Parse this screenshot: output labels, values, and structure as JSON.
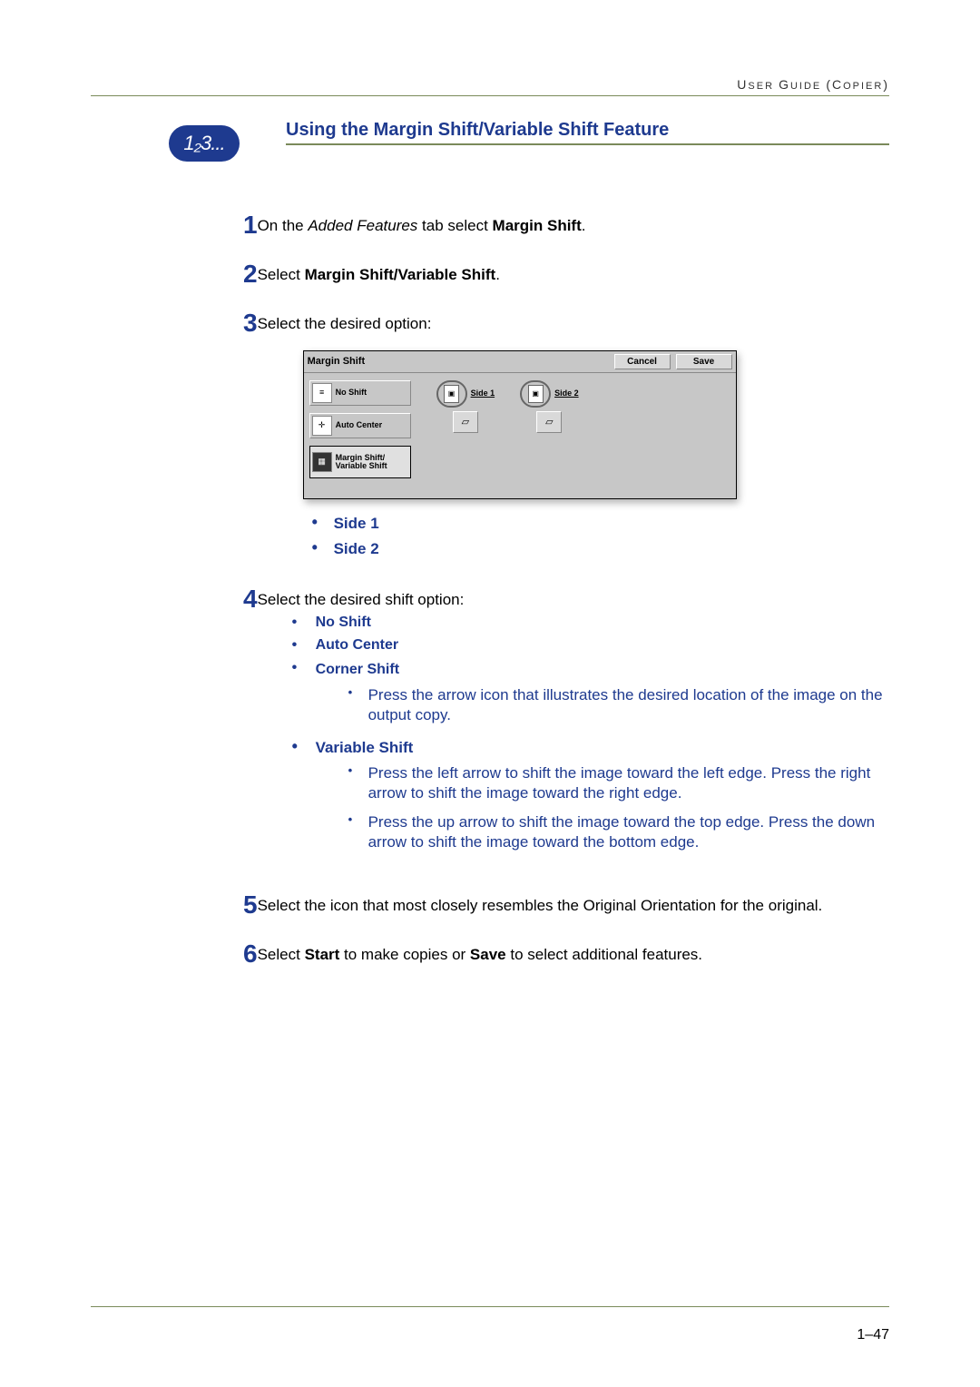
{
  "header": {
    "right_1": "U",
    "right_2": "SER ",
    "right_3": "G",
    "right_4": "UIDE ",
    "right_5": "(C",
    "right_6": "OPIER",
    "right_7": ")"
  },
  "title": "Using the Margin Shift/Variable Shift Feature",
  "step_icon": "1₂3...",
  "steps": {
    "s1": {
      "num": "1",
      "txt1": "On the ",
      "txt2": "Added Features",
      "txt3": " tab select ",
      "txt4": "Margin Shift",
      "txt5": "."
    },
    "s2": {
      "num": "2",
      "txt1": "Select ",
      "txt2": "Margin Shift/Variable Shift",
      "txt3": "."
    },
    "s3": {
      "num": "3",
      "txt": "Select the desired option:"
    },
    "s4": {
      "num": "4",
      "txt": "Select the desired shift option:"
    },
    "s5": {
      "num": "5",
      "txt": "Select the icon that most closely resembles the Original Orientation for the original."
    },
    "s6": {
      "num": "6",
      "txt1": "Select ",
      "txt2": "Start",
      "txt3": " to make copies or ",
      "txt4": "Save",
      "txt5": " to select additional features."
    }
  },
  "ui": {
    "title": "Margin Shift",
    "cancel": "Cancel",
    "save": "Save",
    "opts": {
      "no_shift": "No Shift",
      "auto_center": "Auto Center",
      "margin_var_1": "Margin Shift/",
      "margin_var_2": "Variable Shift"
    },
    "side1": "Side 1",
    "side2": "Side 2"
  },
  "side_bullets": {
    "b1": "Side 1",
    "b2": "Side 2"
  },
  "shift_bullets": {
    "no_shift": "No Shift",
    "auto_center": "Auto Center",
    "corner_shift": "Corner Shift",
    "variable_shift": "Variable Shift"
  },
  "corner_sub": "Press the arrow icon that illustrates the desired location of the image on the output copy.",
  "variable_sub": {
    "a": "Press the left arrow to shift the image toward the left edge. Press the right arrow to shift the image toward the right edge.",
    "b": "Press the up arrow to shift the image toward the top edge. Press the down arrow to shift the image toward the bottom edge."
  },
  "page_number": "1–47"
}
